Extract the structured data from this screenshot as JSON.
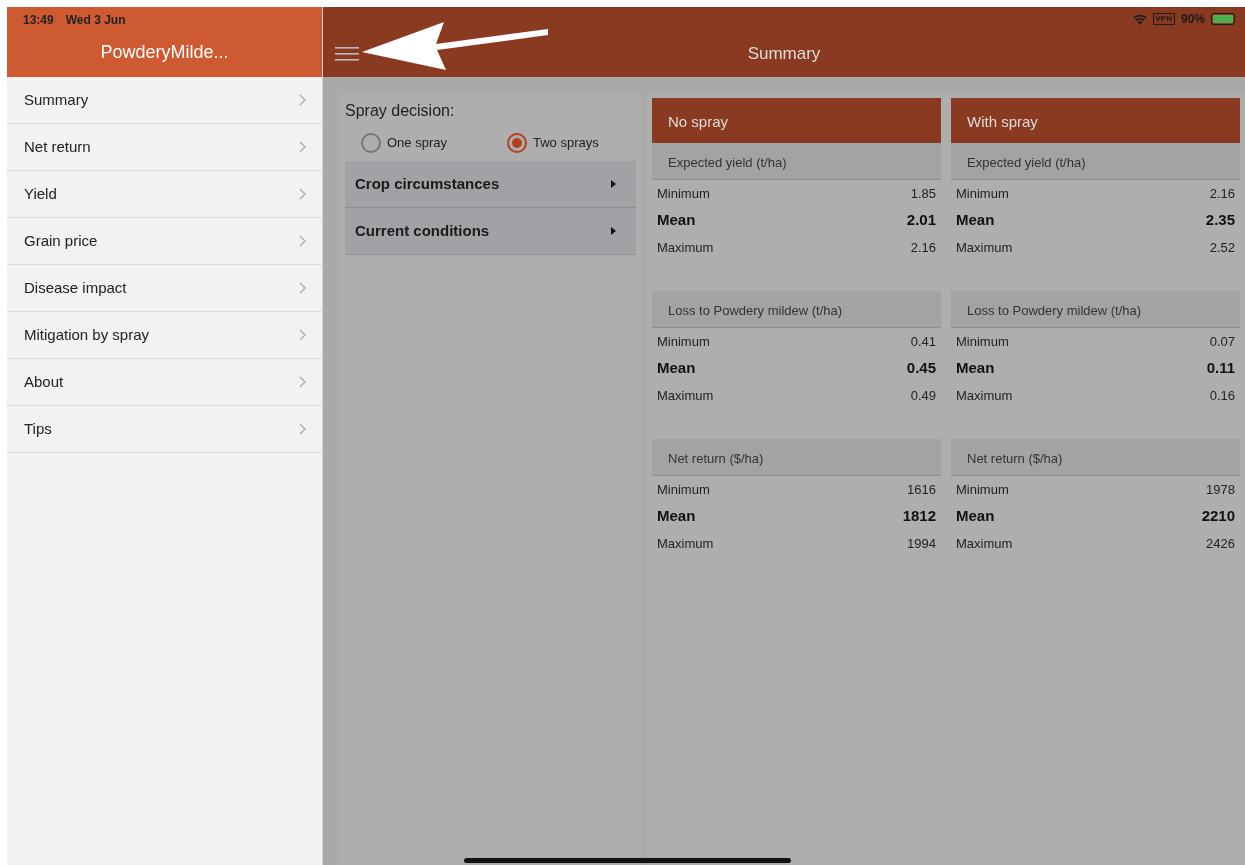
{
  "status_bar": {
    "time": "13:49",
    "date": "Wed 3 Jun",
    "vpn": "VPN",
    "battery": "90%"
  },
  "sidebar": {
    "title": "PowderyMilde...",
    "items": [
      {
        "label": "Summary"
      },
      {
        "label": "Net return"
      },
      {
        "label": "Yield"
      },
      {
        "label": "Grain price"
      },
      {
        "label": "Disease impact"
      },
      {
        "label": "Mitigation by spray"
      },
      {
        "label": "About"
      },
      {
        "label": "Tips"
      }
    ]
  },
  "header": {
    "title": "Summary"
  },
  "spray_decision": {
    "label": "Spray decision:",
    "options": [
      {
        "label": "One spray",
        "selected": false
      },
      {
        "label": "Two sprays",
        "selected": true
      }
    ]
  },
  "sections": [
    {
      "title": "Crop circumstances",
      "expanded": false
    },
    {
      "title": "Current conditions",
      "expanded": false
    }
  ],
  "scenarios": [
    {
      "title": "No spray",
      "groups": [
        {
          "title": "Expected yield (t/ha)",
          "rows": [
            {
              "label": "Minimum",
              "value": "1.85",
              "bold": false
            },
            {
              "label": "Mean",
              "value": "2.01",
              "bold": true
            },
            {
              "label": "Maximum",
              "value": "2.16",
              "bold": false
            }
          ]
        },
        {
          "title": "Loss to Powdery mildew (t/ha)",
          "rows": [
            {
              "label": "Minimum",
              "value": "0.41",
              "bold": false
            },
            {
              "label": "Mean",
              "value": "0.45",
              "bold": true
            },
            {
              "label": "Maximum",
              "value": "0.49",
              "bold": false
            }
          ]
        },
        {
          "title": "Net return ($/ha)",
          "rows": [
            {
              "label": "Minimum",
              "value": "1616",
              "bold": false
            },
            {
              "label": "Mean",
              "value": "1812",
              "bold": true
            },
            {
              "label": "Maximum",
              "value": "1994",
              "bold": false
            }
          ]
        }
      ]
    },
    {
      "title": "With spray",
      "groups": [
        {
          "title": "Expected yield (t/ha)",
          "rows": [
            {
              "label": "Minimum",
              "value": "2.16",
              "bold": false
            },
            {
              "label": "Mean",
              "value": "2.35",
              "bold": true
            },
            {
              "label": "Maximum",
              "value": "2.52",
              "bold": false
            }
          ]
        },
        {
          "title": "Loss to Powdery mildew (t/ha)",
          "rows": [
            {
              "label": "Minimum",
              "value": "0.07",
              "bold": false
            },
            {
              "label": "Mean",
              "value": "0.11",
              "bold": true
            },
            {
              "label": "Maximum",
              "value": "0.16",
              "bold": false
            }
          ]
        },
        {
          "title": "Net return ($/ha)",
          "rows": [
            {
              "label": "Minimum",
              "value": "1978",
              "bold": false
            },
            {
              "label": "Mean",
              "value": "2210",
              "bold": true
            },
            {
              "label": "Maximum",
              "value": "2426",
              "bold": false
            }
          ]
        }
      ]
    }
  ]
}
